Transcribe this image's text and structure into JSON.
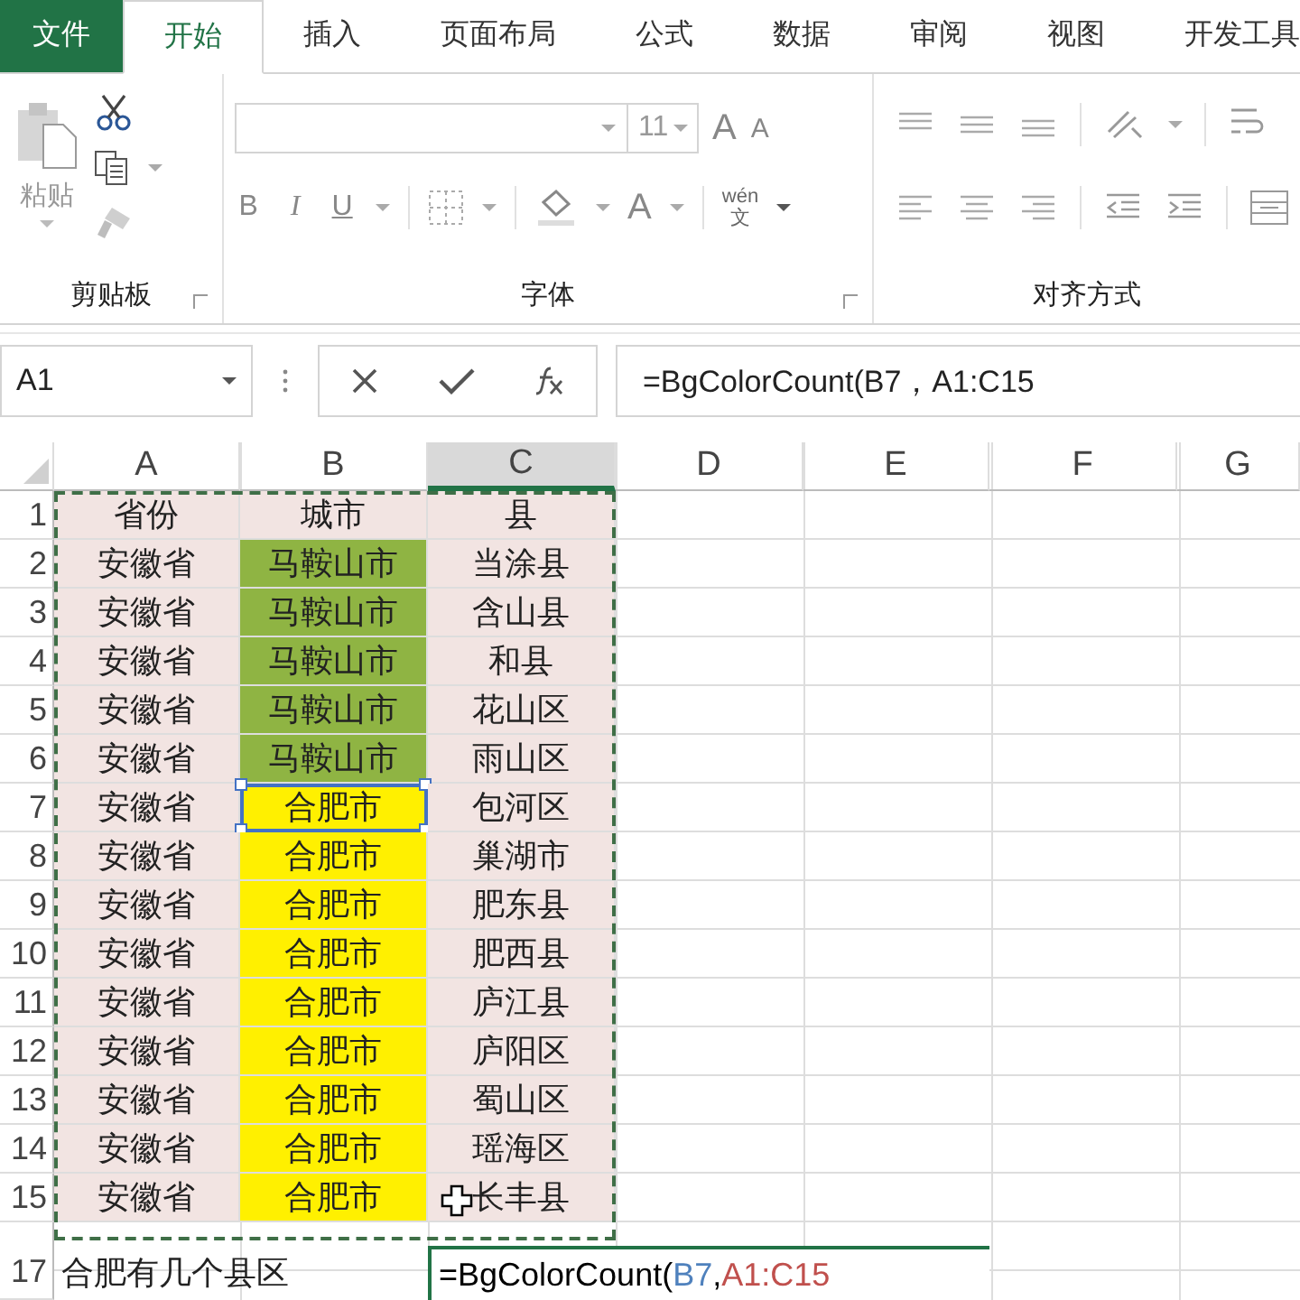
{
  "tabs": [
    {
      "label": "文件",
      "kind": "file",
      "selected": false
    },
    {
      "label": "开始",
      "kind": "tab",
      "selected": true
    },
    {
      "label": "插入",
      "kind": "tab",
      "selected": false
    },
    {
      "label": "页面布局",
      "kind": "tab",
      "selected": false
    },
    {
      "label": "公式",
      "kind": "tab",
      "selected": false
    },
    {
      "label": "数据",
      "kind": "tab",
      "selected": false
    },
    {
      "label": "审阅",
      "kind": "tab",
      "selected": false
    },
    {
      "label": "视图",
      "kind": "tab",
      "selected": false
    },
    {
      "label": "开发工具",
      "kind": "tab",
      "selected": false
    }
  ],
  "ribbon": {
    "paste_label": "粘贴",
    "font_size": "11",
    "grow_font": "A",
    "shrink_font": "A",
    "bold": "B",
    "italic": "I",
    "underline": "U",
    "font_color": "A",
    "phonetic_top": "wén",
    "phonetic_bottom": "文",
    "groups": [
      "剪贴板",
      "字体",
      "对齐方式"
    ]
  },
  "name_box": "A1",
  "formula": "=BgColorCount(B7，A1:C15",
  "columns": [
    {
      "label": "A",
      "selected": false
    },
    {
      "label": "B",
      "selected": false
    },
    {
      "label": "C",
      "selected": true
    },
    {
      "label": "D",
      "selected": false
    },
    {
      "label": "E",
      "selected": false
    },
    {
      "label": "F",
      "selected": false
    },
    {
      "label": "G",
      "selected": false
    }
  ],
  "rows": [
    {
      "number": "1",
      "cells": [
        {
          "text": "省份",
          "color": "#f2e4e2",
          "selected": false
        },
        {
          "text": "城市",
          "color": "#f2e4e2",
          "selected": false
        },
        {
          "text": "县",
          "color": "#f2e4e2",
          "selected": false
        }
      ]
    },
    {
      "number": "2",
      "cells": [
        {
          "text": "安徽省",
          "color": "#f2e4e2",
          "selected": false
        },
        {
          "text": "马鞍山市",
          "color": "#8fb443",
          "selected": false
        },
        {
          "text": "当涂县",
          "color": "#f2e4e2",
          "selected": false
        }
      ]
    },
    {
      "number": "3",
      "cells": [
        {
          "text": "安徽省",
          "color": "#f2e4e2",
          "selected": false
        },
        {
          "text": "马鞍山市",
          "color": "#8fb443",
          "selected": false
        },
        {
          "text": "含山县",
          "color": "#f2e4e2",
          "selected": false
        }
      ]
    },
    {
      "number": "4",
      "cells": [
        {
          "text": "安徽省",
          "color": "#f2e4e2",
          "selected": false
        },
        {
          "text": "马鞍山市",
          "color": "#8fb443",
          "selected": false
        },
        {
          "text": "和县",
          "color": "#f2e4e2",
          "selected": false
        }
      ]
    },
    {
      "number": "5",
      "cells": [
        {
          "text": "安徽省",
          "color": "#f2e4e2",
          "selected": false
        },
        {
          "text": "马鞍山市",
          "color": "#8fb443",
          "selected": false
        },
        {
          "text": "花山区",
          "color": "#f2e4e2",
          "selected": false
        }
      ]
    },
    {
      "number": "6",
      "cells": [
        {
          "text": "安徽省",
          "color": "#f2e4e2",
          "selected": false
        },
        {
          "text": "马鞍山市",
          "color": "#8fb443",
          "selected": false
        },
        {
          "text": "雨山区",
          "color": "#f2e4e2",
          "selected": false
        }
      ]
    },
    {
      "number": "7",
      "cells": [
        {
          "text": "安徽省",
          "color": "#f2e4e2",
          "selected": false
        },
        {
          "text": "合肥市",
          "color": "#fff000",
          "selected": true
        },
        {
          "text": "包河区",
          "color": "#f2e4e2",
          "selected": false
        }
      ]
    },
    {
      "number": "8",
      "cells": [
        {
          "text": "安徽省",
          "color": "#f2e4e2",
          "selected": false
        },
        {
          "text": "合肥市",
          "color": "#fff000",
          "selected": false
        },
        {
          "text": "巢湖市",
          "color": "#f2e4e2",
          "selected": false
        }
      ]
    },
    {
      "number": "9",
      "cells": [
        {
          "text": "安徽省",
          "color": "#f2e4e2",
          "selected": false
        },
        {
          "text": "合肥市",
          "color": "#fff000",
          "selected": false
        },
        {
          "text": "肥东县",
          "color": "#f2e4e2",
          "selected": false
        }
      ]
    },
    {
      "number": "10",
      "cells": [
        {
          "text": "安徽省",
          "color": "#f2e4e2",
          "selected": false
        },
        {
          "text": "合肥市",
          "color": "#fff000",
          "selected": false
        },
        {
          "text": "肥西县",
          "color": "#f2e4e2",
          "selected": false
        }
      ]
    },
    {
      "number": "11",
      "cells": [
        {
          "text": "安徽省",
          "color": "#f2e4e2",
          "selected": false
        },
        {
          "text": "合肥市",
          "color": "#fff000",
          "selected": false
        },
        {
          "text": "庐江县",
          "color": "#f2e4e2",
          "selected": false
        }
      ]
    },
    {
      "number": "12",
      "cells": [
        {
          "text": "安徽省",
          "color": "#f2e4e2",
          "selected": false
        },
        {
          "text": "合肥市",
          "color": "#fff000",
          "selected": false
        },
        {
          "text": "庐阳区",
          "color": "#f2e4e2",
          "selected": false
        }
      ]
    },
    {
      "number": "13",
      "cells": [
        {
          "text": "安徽省",
          "color": "#f2e4e2",
          "selected": false
        },
        {
          "text": "合肥市",
          "color": "#fff000",
          "selected": false
        },
        {
          "text": "蜀山区",
          "color": "#f2e4e2",
          "selected": false
        }
      ]
    },
    {
      "number": "14",
      "cells": [
        {
          "text": "安徽省",
          "color": "#f2e4e2",
          "selected": false
        },
        {
          "text": "合肥市",
          "color": "#fff000",
          "selected": false
        },
        {
          "text": "瑶海区",
          "color": "#f2e4e2",
          "selected": false
        }
      ]
    },
    {
      "number": "15",
      "cells": [
        {
          "text": "安徽省",
          "color": "#f2e4e2",
          "selected": false
        },
        {
          "text": "合肥市",
          "color": "#fff000",
          "selected": false
        },
        {
          "text": "长丰县",
          "color": "#f2e4e2",
          "selected": false
        }
      ]
    }
  ],
  "entry_row": {
    "number": "17",
    "label": "合肥有几个县区",
    "formula_parts": [
      {
        "text": "=BgColorCount(",
        "color": "#000000"
      },
      {
        "text": "B7",
        "color": "#4f81bd"
      },
      {
        "text": ",",
        "color": "#000000"
      },
      {
        "text": "A1:C15",
        "color": "#c0504d"
      }
    ]
  }
}
